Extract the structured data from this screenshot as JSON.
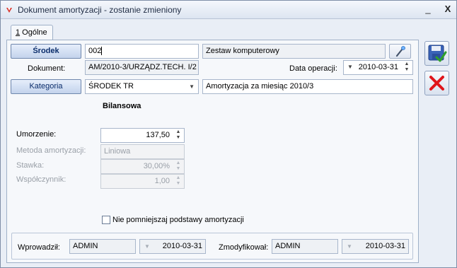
{
  "window": {
    "title": "Dokument amortyzacji - zostanie zmieniony",
    "minimize_label": "_",
    "close_label": "X"
  },
  "tabs": [
    {
      "hotkey": "1",
      "label": " Ogólne"
    }
  ],
  "form": {
    "srodek_button": "Środek",
    "srodek_code": "002",
    "srodek_name": "Zestaw komputerowy",
    "dokument_label": "Dokument:",
    "dokument_value": "AM/2010-3/URZĄDZ.TECH. I/2",
    "data_operacji_label": "Data operacji:",
    "data_operacji_value": "2010-03-31",
    "kategoria_button": "Kategoria",
    "kategoria_value": "ŚRODEK TR",
    "opis_value": "Amortyzacja za miesiąc 2010/3",
    "section_title": "Bilansowa",
    "umorzenie_label": "Umorzenie:",
    "umorzenie_value": "137,50",
    "metoda_label": "Metoda amortyzacji:",
    "metoda_value": "Liniowa",
    "stawka_label": "Stawka:",
    "stawka_value": "30,00%",
    "wspolczynnik_label": "Współczynnik:",
    "wspolczynnik_value": "1,00",
    "checkbox_label": "Nie pomniejszaj podstawy amortyzacji",
    "checkbox_checked": false
  },
  "footer": {
    "wprowadzil_label": "Wprowadził:",
    "wprowadzil_user": "ADMIN",
    "wprowadzil_date": "2010-03-31",
    "zmodyfikowal_label": "Zmodyfikował:",
    "zmodyfikowal_user": "ADMIN",
    "zmodyfikowal_date": "2010-03-31"
  },
  "icons": {
    "app": "app-icon",
    "wand": "magic-wand-icon",
    "save": "save-disk-icon",
    "cancel": "cancel-x-icon"
  },
  "colors": {
    "accent_blue": "#0b2d6b",
    "cancel_red": "#e0161b",
    "save_check_green": "#2fa12a"
  }
}
